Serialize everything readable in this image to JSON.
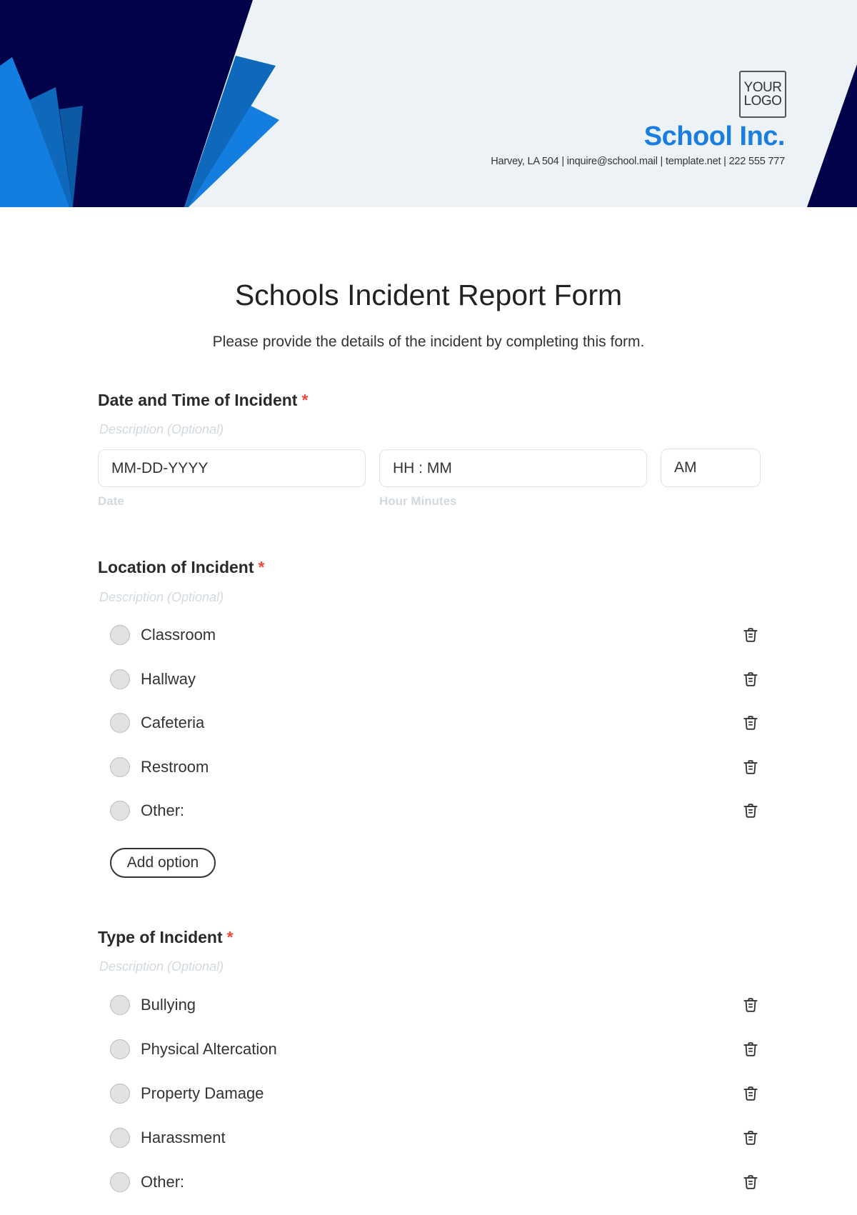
{
  "header": {
    "logo_line1": "YOUR",
    "logo_line2": "LOGO",
    "company_name": "School Inc.",
    "contact": "Harvey, LA 504 | inquire@school.mail | template.net | 222 555 777",
    "colors": {
      "navy": "#02024a",
      "blue": "#137de0",
      "mid_blue": "#0e68bb",
      "dark_blue": "#0c5aa3",
      "bg": "#edf2f7"
    }
  },
  "form": {
    "title": "Schools Incident Report Form",
    "subtitle": "Please provide the details of the incident by completing this form."
  },
  "questions": {
    "datetime": {
      "title": "Date and Time of Incident",
      "required_mark": "*",
      "description": "Description (Optional)",
      "date_placeholder": "MM-DD-YYYY",
      "date_label": "Date",
      "time_placeholder": "HH : MM",
      "time_label": "Hour Minutes",
      "ampm_value": "AM"
    },
    "location": {
      "title": "Location of Incident",
      "required_mark": "*",
      "description": "Description (Optional)",
      "options": [
        "Classroom",
        "Hallway",
        "Cafeteria",
        "Restroom",
        "Other:"
      ],
      "add_option_label": "Add option"
    },
    "type": {
      "title": "Type of Incident",
      "required_mark": "*",
      "description": "Description (Optional)",
      "options": [
        "Bullying",
        "Physical Altercation",
        "Property Damage",
        "Harassment",
        "Other:"
      ]
    }
  },
  "icons": {
    "delete": "trash-icon",
    "radio": "radio-button"
  },
  "accent_required": "#ef4a3a"
}
